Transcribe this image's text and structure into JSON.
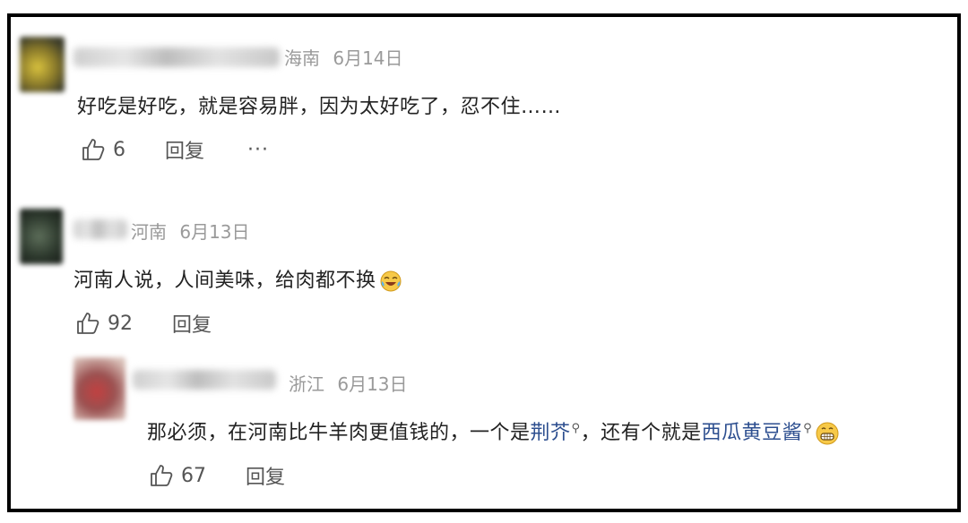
{
  "comments": [
    {
      "location": "海南",
      "date": "6月14日",
      "text": "好吃是好吃，就是容易胖，因为太好吃了，忍不住……",
      "likes": "6",
      "reply_label": "回复",
      "more_label": "···",
      "avatar_color": "#c9b23a"
    },
    {
      "location": "河南",
      "date": "6月13日",
      "text": "河南人说，人间美味，给肉都不换",
      "emoji": "laughing-tears-emoji",
      "likes": "92",
      "reply_label": "回复",
      "avatar_color": "#3a4a3a"
    }
  ],
  "reply": {
    "location": "浙江",
    "date": "6月13日",
    "text_parts": [
      "那必须，在河南比牛羊肉更值钱的，一个是",
      "荆芥",
      "，还有个就是",
      "西瓜黄豆酱"
    ],
    "emoji": "grinning-emoji",
    "likes": "67",
    "reply_label": "回复",
    "avatar_color": "#b84040",
    "link_color": "#2c4e8f"
  }
}
